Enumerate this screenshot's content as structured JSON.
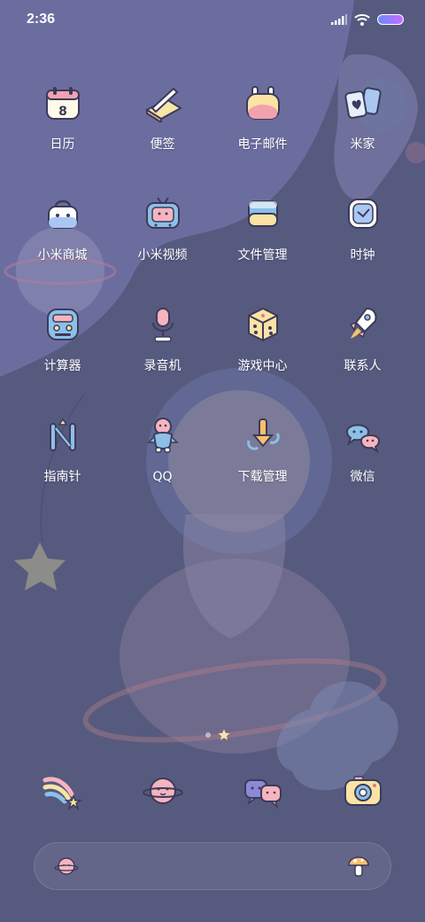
{
  "status_bar": {
    "time": "2:36",
    "icons": [
      "signal-icon",
      "wifi-icon",
      "battery-icon"
    ]
  },
  "apps": [
    {
      "label": "日历",
      "icon": "calendar-icon",
      "badge": "8"
    },
    {
      "label": "便签",
      "icon": "notes-icon"
    },
    {
      "label": "电子邮件",
      "icon": "email-icon"
    },
    {
      "label": "米家",
      "icon": "mi-home-icon"
    },
    {
      "label": "小米商城",
      "icon": "mi-store-icon"
    },
    {
      "label": "小米视频",
      "icon": "mi-video-icon"
    },
    {
      "label": "文件管理",
      "icon": "file-manager-icon"
    },
    {
      "label": "时钟",
      "icon": "clock-icon"
    },
    {
      "label": "计算器",
      "icon": "calculator-icon"
    },
    {
      "label": "录音机",
      "icon": "recorder-icon"
    },
    {
      "label": "游戏中心",
      "icon": "game-center-icon"
    },
    {
      "label": "联系人",
      "icon": "contacts-icon"
    },
    {
      "label": "指南针",
      "icon": "compass-icon"
    },
    {
      "label": "QQ",
      "icon": "qq-icon"
    },
    {
      "label": "下载管理",
      "icon": "downloads-icon"
    },
    {
      "label": "微信",
      "icon": "wechat-icon"
    }
  ],
  "dock": [
    {
      "icon": "rainbow-star-icon"
    },
    {
      "icon": "planet-face-icon"
    },
    {
      "icon": "chat-bubbles-icon"
    },
    {
      "icon": "camera-icon"
    }
  ],
  "page_indicator": {
    "pages": 2,
    "current": 2
  },
  "search_bar": {
    "left_icon": "planet-mascot-icon",
    "right_icon": "mushroom-icon"
  },
  "colors": {
    "background": "#565a7f",
    "wallpaper_light": "#6c6d9f",
    "label_text": "#ffffff",
    "battery": "#9a7cff"
  }
}
